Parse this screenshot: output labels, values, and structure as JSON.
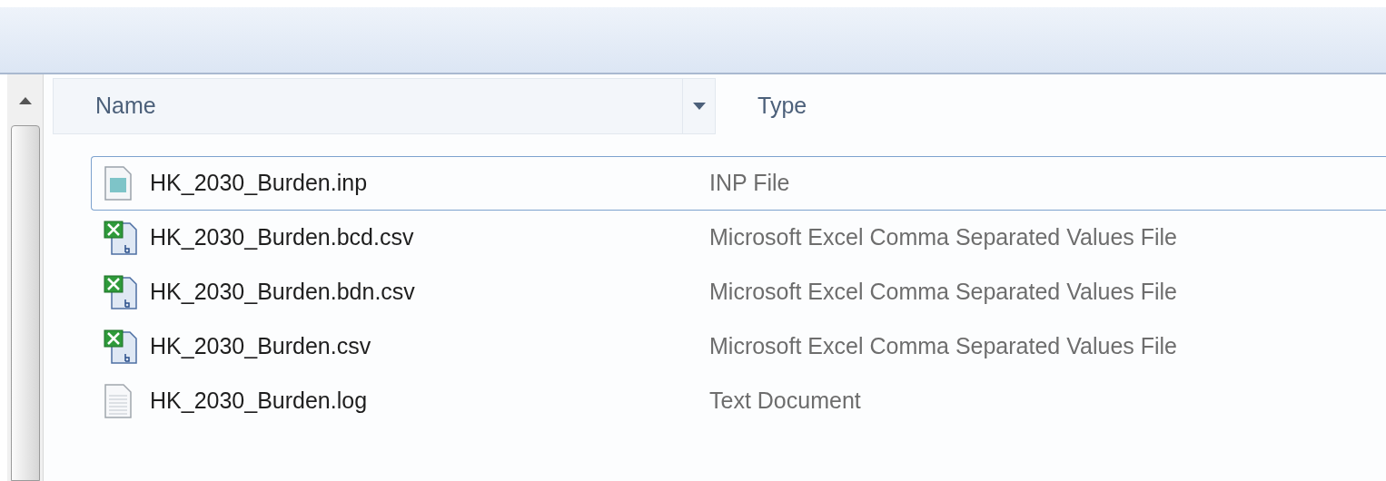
{
  "columns": [
    {
      "label": "Name",
      "sort_menu": true,
      "hovered": true
    },
    {
      "label": "Type",
      "sort_menu": false,
      "hovered": false
    }
  ],
  "rows": [
    {
      "name": "HK_2030_Burden.inp",
      "type": "INP File",
      "kind": "generic",
      "focused": true
    },
    {
      "name": "HK_2030_Burden.bcd.csv",
      "type": "Microsoft Excel Comma Separated Values File",
      "kind": "excel",
      "focused": false
    },
    {
      "name": "HK_2030_Burden.bdn.csv",
      "type": "Microsoft Excel Comma Separated Values File",
      "kind": "excel",
      "focused": false
    },
    {
      "name": "HK_2030_Burden.csv",
      "type": "Microsoft Excel Comma Separated Values File",
      "kind": "excel",
      "focused": false
    },
    {
      "name": "HK_2030_Burden.log",
      "type": "Text Document",
      "kind": "text",
      "focused": false
    }
  ]
}
